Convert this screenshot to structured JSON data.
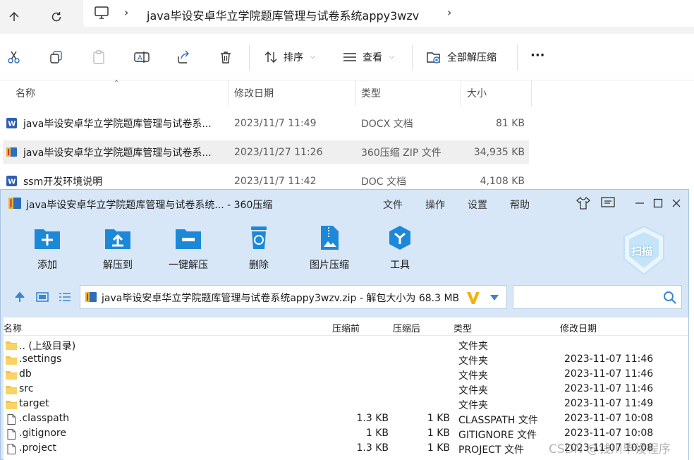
{
  "explorer": {
    "breadcrumb": "java毕设安卓华立学院题库管理与试卷系统appy3wzv",
    "toolbar": {
      "sort_label": "排序",
      "view_label": "查看",
      "extract_all_label": "全部解压缩",
      "more_label": "···"
    },
    "columns": {
      "name": "名称",
      "modified": "修改日期",
      "type": "类型",
      "size": "大小"
    },
    "files": [
      {
        "name": "java毕设安卓华立学院题库管理与试卷系...",
        "modified": "2023/11/7 11:49",
        "type": "DOCX 文档",
        "size": "81 KB",
        "icon": "word-doc-icon"
      },
      {
        "name": "java毕设安卓华立学院题库管理与试卷系...",
        "modified": "2023/11/27 11:26",
        "type": "360压缩 ZIP 文件",
        "size": "34,935 KB",
        "icon": "zip-archive-icon"
      },
      {
        "name": "ssm开发环境说明",
        "modified": "2023/11/7 11:42",
        "type": "DOC 文档",
        "size": "4,108 KB",
        "icon": "word-doc-icon"
      }
    ]
  },
  "archiver": {
    "title": "java毕设安卓华立学院题库管理与试卷系统... - 360压缩",
    "menu": [
      "文件",
      "操作",
      "设置",
      "帮助"
    ],
    "tools": [
      {
        "label": "添加",
        "icon": "add-icon"
      },
      {
        "label": "解压到",
        "icon": "extract-to-icon"
      },
      {
        "label": "一键解压",
        "icon": "one-click-extract-icon"
      },
      {
        "label": "删除",
        "icon": "delete-icon"
      },
      {
        "label": "图片压缩",
        "icon": "image-compress-icon"
      },
      {
        "label": "工具",
        "icon": "tools-icon"
      }
    ],
    "scan_label": "扫描",
    "path": "java毕设安卓华立学院题库管理与试卷系统appy3wzv.zip - 解包大小为 68.3 MB",
    "columns": {
      "name": "名称",
      "packed": "压缩前",
      "compressed": "压缩后",
      "type": "类型",
      "modified": "修改日期"
    },
    "entries": [
      {
        "name": ".. (上级目录)",
        "packed": "",
        "compressed": "",
        "type": "文件夹",
        "modified": "",
        "kind": "folder"
      },
      {
        "name": ".settings",
        "packed": "",
        "compressed": "",
        "type": "文件夹",
        "modified": "2023-11-07 11:46",
        "kind": "folder"
      },
      {
        "name": "db",
        "packed": "",
        "compressed": "",
        "type": "文件夹",
        "modified": "2023-11-07 11:46",
        "kind": "folder"
      },
      {
        "name": "src",
        "packed": "",
        "compressed": "",
        "type": "文件夹",
        "modified": "2023-11-07 11:46",
        "kind": "folder"
      },
      {
        "name": "target",
        "packed": "",
        "compressed": "",
        "type": "文件夹",
        "modified": "2023-11-07 11:49",
        "kind": "folder"
      },
      {
        "name": ".classpath",
        "packed": "1.3 KB",
        "compressed": "1 KB",
        "type": "CLASSPATH 文件",
        "modified": "2023-11-07 10:08",
        "kind": "file"
      },
      {
        "name": ".gitignore",
        "packed": "1 KB",
        "compressed": "1 KB",
        "type": "GITIGNORE 文件",
        "modified": "2023-11-07 10:08",
        "kind": "file"
      },
      {
        "name": ".project",
        "packed": "1.3 KB",
        "compressed": "1 KB",
        "type": "PROJECT 文件",
        "modified": "2023-11-07 10:08",
        "kind": "file"
      }
    ]
  },
  "watermark": "CSDN @钱川毕设程序",
  "colors": {
    "accent_blue": "#1e88d8",
    "folder_yellow": "#f5c342",
    "word_blue": "#2b5fb4"
  }
}
